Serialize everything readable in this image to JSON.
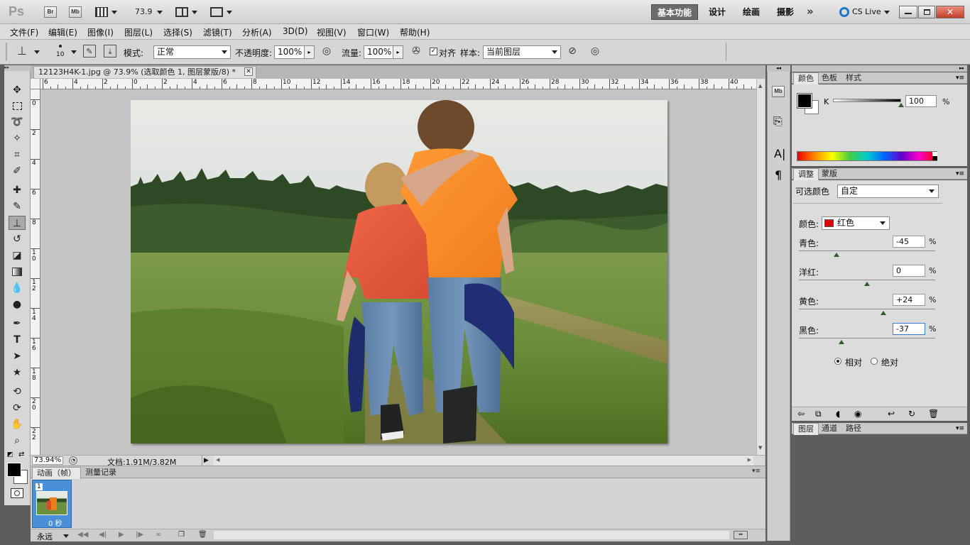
{
  "appbar": {
    "logo": "Ps",
    "bridge": "Br",
    "minibridge": "Mb",
    "zoom": "73.9",
    "workspaces": [
      "基本功能",
      "设计",
      "绘画",
      "摄影"
    ],
    "cslive": "CS Live"
  },
  "menu": [
    "文件(F)",
    "编辑(E)",
    "图像(I)",
    "图层(L)",
    "选择(S)",
    "滤镜(T)",
    "分析(A)",
    "3D(D)",
    "视图(V)",
    "窗口(W)",
    "帮助(H)"
  ],
  "options": {
    "brush_size": "10",
    "mode_label": "模式:",
    "mode_value": "正常",
    "opacity_label": "不透明度:",
    "opacity_value": "100%",
    "flow_label": "流量:",
    "flow_value": "100%",
    "align_label": "对齐",
    "sample_label": "样本:",
    "sample_value": "当前图层"
  },
  "document": {
    "tab_title": "12123H4K-1.jpg @ 73.9% (选取颜色 1, 图层蒙版/8) *",
    "zoom": "73.94%",
    "doc_size": "文档:1.91M/3.82M",
    "ruler_top": [
      "6",
      "4",
      "2",
      "0",
      "2",
      "4",
      "6",
      "8",
      "10",
      "12",
      "14",
      "16",
      "18",
      "20",
      "22",
      "24",
      "26",
      "28",
      "30",
      "32",
      "34",
      "36",
      "38",
      "40"
    ],
    "ruler_left": [
      "0",
      "2",
      "4",
      "6",
      "8",
      "1 0",
      "1 2",
      "1 4",
      "1 6",
      "1 8",
      "2 0",
      "2 2"
    ]
  },
  "animation": {
    "tabs": [
      "动画（帧）",
      "测量记录"
    ],
    "frame_number": "1",
    "frame_delay": "0 秒",
    "loop": "永远"
  },
  "color_panel": {
    "tabs": [
      "颜色",
      "色板",
      "样式"
    ],
    "channel": "K",
    "value": "100",
    "unit": "%"
  },
  "adjust_panel": {
    "tabs": [
      "调整",
      "蒙版"
    ],
    "title": "可选颜色",
    "preset": "自定",
    "colors_label": "颜色:",
    "colors_value": "红色",
    "swatch": "#e00000",
    "sliders": [
      {
        "label": "青色:",
        "value": "-45",
        "level": -45
      },
      {
        "label": "洋红:",
        "value": "0",
        "level": 0
      },
      {
        "label": "黄色:",
        "value": "+24",
        "level": 24
      },
      {
        "label": "黑色:",
        "value": "-37",
        "level": -37
      }
    ],
    "unit": "%",
    "relative": "相对",
    "absolute": "绝对"
  },
  "layers_panel": {
    "tabs": [
      "图层",
      "通道",
      "路径"
    ]
  }
}
